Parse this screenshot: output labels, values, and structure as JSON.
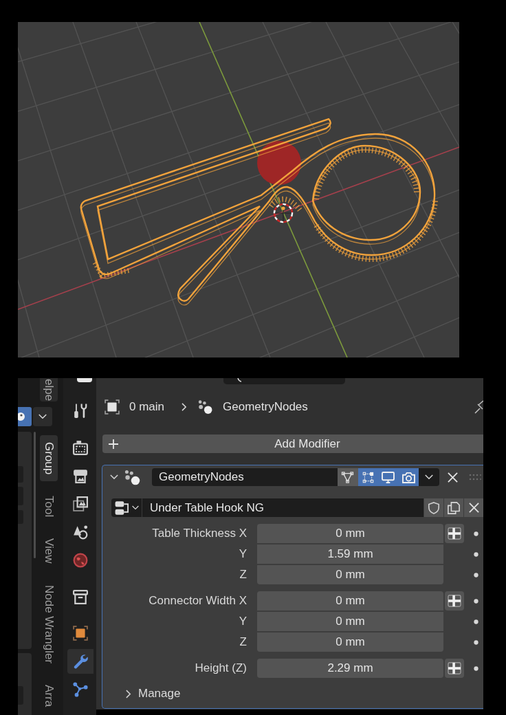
{
  "viewport": {
    "object": {
      "selected": true
    }
  },
  "sidebar": {
    "upper_tab": {
      "label": "elpe"
    },
    "header_toggle": {
      "on": true
    },
    "tabs": [
      {
        "label": "Group",
        "selected": true
      },
      {
        "label": "Tool",
        "selected": false
      },
      {
        "label": "View",
        "selected": false
      },
      {
        "label": "Node Wrangler",
        "selected": false
      },
      {
        "label": "Arra",
        "selected": false
      }
    ]
  },
  "property_tabs": [
    {
      "tabs": [
        {
          "kind": "tool",
          "selected": false
        }
      ]
    },
    {
      "tabs": [
        {
          "kind": "render",
          "selected": false
        },
        {
          "kind": "output",
          "selected": false
        },
        {
          "kind": "view_layer",
          "selected": false
        },
        {
          "kind": "scene",
          "selected": false
        },
        {
          "kind": "world",
          "selected": false
        }
      ]
    },
    {
      "tabs": [
        {
          "kind": "collection",
          "selected": false
        }
      ]
    },
    {
      "tabs": [
        {
          "kind": "object",
          "selected": false
        },
        {
          "kind": "modifiers",
          "selected": true
        },
        {
          "kind": "particles",
          "selected": false
        }
      ]
    }
  ],
  "breadcrumb": [
    {
      "kind": "object",
      "label": "0 main"
    },
    {
      "kind": "modifier",
      "label": "GeometryNodes"
    }
  ],
  "add_modifier": {
    "label": "Add Modifier"
  },
  "modifier": {
    "active": true,
    "expanded": true,
    "name": "GeometryNodes",
    "toggles": [
      {
        "kind": "edit_mode",
        "on": false
      },
      {
        "kind": "on_cage",
        "on": true
      },
      {
        "kind": "viewport",
        "on": true
      },
      {
        "kind": "render",
        "on": true
      }
    ],
    "node_group": {
      "name": "Under Table Hook NG"
    },
    "input_groups": [
      {
        "rows": [
          {
            "label": "Table Thickness X",
            "value": "0 mm"
          },
          {
            "label": "Y",
            "value": "1.59 mm"
          },
          {
            "label": "Z",
            "value": "0 mm"
          }
        ]
      },
      {
        "rows": [
          {
            "label": "Connector Width X",
            "value": "0 mm"
          },
          {
            "label": "Y",
            "value": "0 mm"
          },
          {
            "label": "Z",
            "value": "0 mm"
          }
        ]
      },
      {
        "rows": [
          {
            "label": "Height (Z)",
            "value": "2.29 mm"
          }
        ]
      }
    ],
    "manage": {
      "label": "Manage",
      "expanded": false
    }
  }
}
